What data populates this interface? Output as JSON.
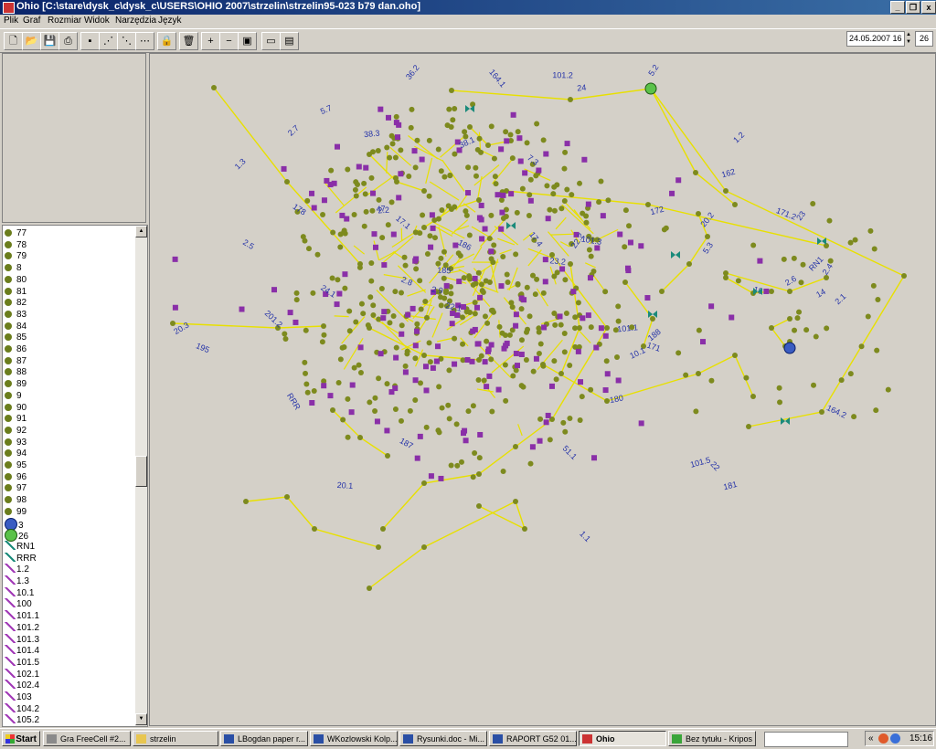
{
  "window": {
    "title": "Ohio [C:\\stare\\dysk_c\\dysk_c\\USERS\\OHIO 2007\\strzelin\\strzelin95-023 b79 dan.oho]",
    "min": "_",
    "max": "❐",
    "close": "x"
  },
  "menu": [
    "Plik",
    "Graf",
    "Rozmiar",
    "Widok",
    "Narzędzia",
    "Język"
  ],
  "toolbar": {
    "date": "24.05.2007 16",
    "zoom": "26"
  },
  "list": [
    {
      "label": "77",
      "kind": "node"
    },
    {
      "label": "78",
      "kind": "node"
    },
    {
      "label": "79",
      "kind": "node"
    },
    {
      "label": "8",
      "kind": "node"
    },
    {
      "label": "80",
      "kind": "node"
    },
    {
      "label": "81",
      "kind": "node"
    },
    {
      "label": "82",
      "kind": "node"
    },
    {
      "label": "83",
      "kind": "node"
    },
    {
      "label": "84",
      "kind": "node"
    },
    {
      "label": "85",
      "kind": "node"
    },
    {
      "label": "86",
      "kind": "node"
    },
    {
      "label": "87",
      "kind": "node"
    },
    {
      "label": "88",
      "kind": "node"
    },
    {
      "label": "89",
      "kind": "node"
    },
    {
      "label": "9",
      "kind": "node"
    },
    {
      "label": "90",
      "kind": "node"
    },
    {
      "label": "91",
      "kind": "node"
    },
    {
      "label": "92",
      "kind": "node"
    },
    {
      "label": "93",
      "kind": "node"
    },
    {
      "label": "94",
      "kind": "node"
    },
    {
      "label": "95",
      "kind": "node"
    },
    {
      "label": "96",
      "kind": "node"
    },
    {
      "label": "97",
      "kind": "node"
    },
    {
      "label": "98",
      "kind": "node"
    },
    {
      "label": "99",
      "kind": "node"
    },
    {
      "label": "3",
      "kind": "blue"
    },
    {
      "label": "26",
      "kind": "green"
    },
    {
      "label": "RN1",
      "kind": "teal"
    },
    {
      "label": "RRR",
      "kind": "teal"
    },
    {
      "label": "1.2",
      "kind": "link"
    },
    {
      "label": "1.3",
      "kind": "link"
    },
    {
      "label": "10.1",
      "kind": "link"
    },
    {
      "label": "100",
      "kind": "link"
    },
    {
      "label": "101.1",
      "kind": "link"
    },
    {
      "label": "101.2",
      "kind": "link"
    },
    {
      "label": "101.3",
      "kind": "link"
    },
    {
      "label": "101.4",
      "kind": "link"
    },
    {
      "label": "101.5",
      "kind": "link"
    },
    {
      "label": "102.1",
      "kind": "link"
    },
    {
      "label": "102.4",
      "kind": "link"
    },
    {
      "label": "103",
      "kind": "link"
    },
    {
      "label": "104.2",
      "kind": "link"
    },
    {
      "label": "105.2",
      "kind": "link"
    }
  ],
  "graph_labels": [
    "101.5",
    "101.3",
    "101.1",
    "101.2",
    "162",
    "164.1",
    "1.3",
    "164.2",
    "1.1",
    "1.2",
    "201.2",
    "20.1",
    "38.1",
    "38.3",
    "20.2",
    "20.3",
    "22.1",
    "22.2",
    "23.2",
    "2.9",
    "2.8",
    "2.7",
    "2.6",
    "2.5",
    "2.4",
    "2.2",
    "2.1",
    "RRR",
    "RN1",
    "5.7",
    "5.2",
    "24",
    "23",
    "22",
    "171",
    "178",
    "180",
    "181",
    "185",
    "186",
    "187",
    "188",
    "195",
    "7.3",
    "172",
    "17.4",
    "17.1",
    "36.2",
    "10.1",
    "14",
    "18",
    "171.2",
    "51.1",
    "5.3",
    "47",
    "24.1"
  ],
  "taskbar": {
    "start": "Start",
    "tasks": [
      "Gra FreeCell #2...",
      "strzelin",
      "LBogdan paper r...",
      "WKozlowski Kolp...",
      "Rysunki.doc - Mi...",
      "RAPORT G52 01...",
      "Ohio",
      "Bez tytułu - Kripos"
    ],
    "clock": "15:16"
  }
}
